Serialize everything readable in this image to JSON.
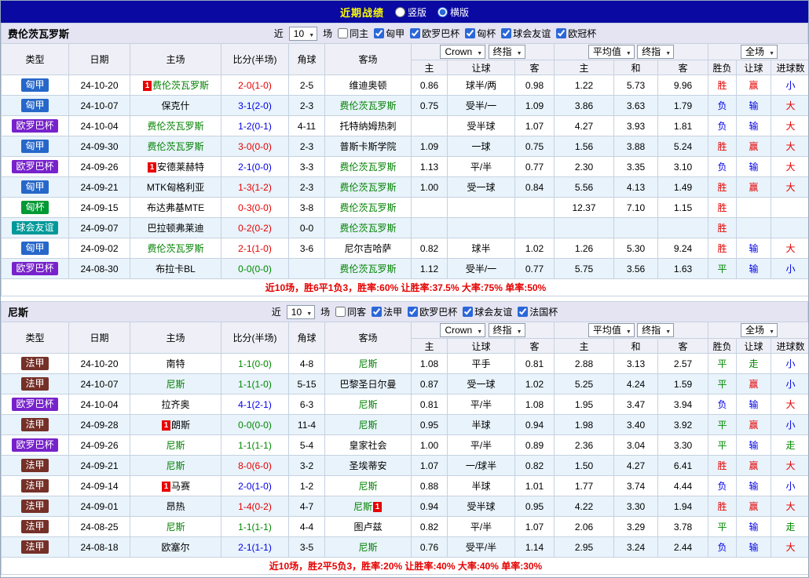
{
  "topbar": {
    "title": "近期战绩",
    "vertical_label": "竖版",
    "horizontal_label": "横版",
    "selected": "横版"
  },
  "controls": {
    "recent_label": "近",
    "count": "10",
    "matches_label": "场",
    "odds_company": "Crown",
    "final_index": "终指",
    "average": "平均值",
    "full_match": "全场"
  },
  "columns": {
    "type": "类型",
    "date": "日期",
    "home": "主场",
    "score": "比分(半场)",
    "corner": "角球",
    "away": "客场",
    "handicap_home": "主",
    "handicap": "让球",
    "handicap_away": "客",
    "odds_home": "主",
    "odds_draw": "和",
    "odds_away": "客",
    "result": "胜负",
    "handicap_result": "让球",
    "goals_result": "进球数"
  },
  "colors": {
    "topbar_bg": "#0A0AA2",
    "win": "#E60000",
    "draw": "#008800",
    "loss": "#0000E6",
    "focus_team": "#008000",
    "alt_row_bg": "#E8F3FB"
  },
  "competition_colors": {
    "匈甲": "#2667C9",
    "欧罗巴杯": "#7722CC",
    "匈杯": "#009933",
    "球会友谊": "#009999",
    "法甲": "#753028",
    "法国杯": "#753028",
    "欧冠杯": "#2667C9"
  },
  "sections": [
    {
      "team": "费伦茨瓦罗斯",
      "filter": {
        "venue_label": "同主",
        "venue_checked": false,
        "competitions": [
          {
            "label": "匈甲",
            "checked": true
          },
          {
            "label": "欧罗巴杯",
            "checked": true
          },
          {
            "label": "匈杯",
            "checked": true
          },
          {
            "label": "球会友谊",
            "checked": true
          },
          {
            "label": "欧冠杯",
            "checked": true
          }
        ]
      },
      "rows": [
        {
          "comp": "匈甲",
          "date": "24-10-20",
          "home": "费伦茨瓦罗斯",
          "home_focus": true,
          "home_card": "1",
          "away": "维迪奥顿",
          "away_focus": false,
          "away_card": "",
          "score": "2-0(1-0)",
          "score_c": "r",
          "corner": "2-5",
          "ah_home": "0.86",
          "ah_line": "球半/两",
          "ah_away": "0.98",
          "o_home": "1.22",
          "o_draw": "5.73",
          "o_away": "9.96",
          "res": "胜",
          "res_c": "r",
          "ah_res": "赢",
          "ah_res_c": "r",
          "ou_res": "小",
          "ou_res_c": "b"
        },
        {
          "comp": "匈甲",
          "date": "24-10-07",
          "home": "保克什",
          "home_focus": false,
          "home_card": "",
          "away": "费伦茨瓦罗斯",
          "away_focus": true,
          "away_card": "",
          "score": "3-1(2-0)",
          "score_c": "b",
          "corner": "2-3",
          "ah_home": "0.75",
          "ah_line": "受半/一",
          "ah_away": "1.09",
          "o_home": "3.86",
          "o_draw": "3.63",
          "o_away": "1.79",
          "res": "负",
          "res_c": "b",
          "ah_res": "输",
          "ah_res_c": "b",
          "ou_res": "大",
          "ou_res_c": "r"
        },
        {
          "comp": "欧罗巴杯",
          "date": "24-10-04",
          "home": "费伦茨瓦罗斯",
          "home_focus": true,
          "home_card": "",
          "away": "托特纳姆热刺",
          "away_focus": false,
          "away_card": "",
          "score": "1-2(0-1)",
          "score_c": "b",
          "corner": "4-11",
          "ah_home": "",
          "ah_line": "受半球",
          "ah_away": "1.07",
          "o_home": "4.27",
          "o_draw": "3.93",
          "o_away": "1.81",
          "res": "负",
          "res_c": "b",
          "ah_res": "输",
          "ah_res_c": "b",
          "ou_res": "大",
          "ou_res_c": "r"
        },
        {
          "comp": "匈甲",
          "date": "24-09-30",
          "home": "费伦茨瓦罗斯",
          "home_focus": true,
          "home_card": "",
          "away": "普斯卡斯学院",
          "away_focus": false,
          "away_card": "",
          "score": "3-0(0-0)",
          "score_c": "r",
          "corner": "2-3",
          "ah_home": "1.09",
          "ah_line": "一球",
          "ah_away": "0.75",
          "o_home": "1.56",
          "o_draw": "3.88",
          "o_away": "5.24",
          "res": "胜",
          "res_c": "r",
          "ah_res": "赢",
          "ah_res_c": "r",
          "ou_res": "大",
          "ou_res_c": "r"
        },
        {
          "comp": "欧罗巴杯",
          "date": "24-09-26",
          "home": "安德莱赫特",
          "home_focus": false,
          "home_card": "1",
          "away": "费伦茨瓦罗斯",
          "away_focus": true,
          "away_card": "",
          "score": "2-1(0-0)",
          "score_c": "b",
          "corner": "3-3",
          "ah_home": "1.13",
          "ah_line": "平/半",
          "ah_away": "0.77",
          "o_home": "2.30",
          "o_draw": "3.35",
          "o_away": "3.10",
          "res": "负",
          "res_c": "b",
          "ah_res": "输",
          "ah_res_c": "b",
          "ou_res": "大",
          "ou_res_c": "r"
        },
        {
          "comp": "匈甲",
          "date": "24-09-21",
          "home": "MTK匈格利亚",
          "home_focus": false,
          "home_card": "",
          "away": "费伦茨瓦罗斯",
          "away_focus": true,
          "away_card": "",
          "score": "1-3(1-2)",
          "score_c": "r",
          "corner": "2-3",
          "ah_home": "1.00",
          "ah_line": "受一球",
          "ah_away": "0.84",
          "o_home": "5.56",
          "o_draw": "4.13",
          "o_away": "1.49",
          "res": "胜",
          "res_c": "r",
          "ah_res": "赢",
          "ah_res_c": "r",
          "ou_res": "大",
          "ou_res_c": "r"
        },
        {
          "comp": "匈杯",
          "date": "24-09-15",
          "home": "布达弗基MTE",
          "home_focus": false,
          "home_card": "",
          "away": "费伦茨瓦罗斯",
          "away_focus": true,
          "away_card": "",
          "score": "0-3(0-0)",
          "score_c": "r",
          "corner": "3-8",
          "ah_home": "",
          "ah_line": "",
          "ah_away": "",
          "o_home": "12.37",
          "o_draw": "7.10",
          "o_away": "1.15",
          "res": "胜",
          "res_c": "r",
          "ah_res": "",
          "ah_res_c": "",
          "ou_res": "",
          "ou_res_c": ""
        },
        {
          "comp": "球会友谊",
          "date": "24-09-07",
          "home": "巴拉顿弗莱迪",
          "home_focus": false,
          "home_card": "",
          "away": "费伦茨瓦罗斯",
          "away_focus": true,
          "away_card": "",
          "score": "0-2(0-2)",
          "score_c": "r",
          "corner": "0-0",
          "ah_home": "",
          "ah_line": "",
          "ah_away": "",
          "o_home": "",
          "o_draw": "",
          "o_away": "",
          "res": "胜",
          "res_c": "r",
          "ah_res": "",
          "ah_res_c": "",
          "ou_res": "",
          "ou_res_c": ""
        },
        {
          "comp": "匈甲",
          "date": "24-09-02",
          "home": "费伦茨瓦罗斯",
          "home_focus": true,
          "home_card": "",
          "away": "尼尔吉哈萨",
          "away_focus": false,
          "away_card": "",
          "score": "2-1(1-0)",
          "score_c": "r",
          "corner": "3-6",
          "ah_home": "0.82",
          "ah_line": "球半",
          "ah_away": "1.02",
          "o_home": "1.26",
          "o_draw": "5.30",
          "o_away": "9.24",
          "res": "胜",
          "res_c": "r",
          "ah_res": "输",
          "ah_res_c": "b",
          "ou_res": "大",
          "ou_res_c": "r"
        },
        {
          "comp": "欧罗巴杯",
          "date": "24-08-30",
          "home": "布拉卡BL",
          "home_focus": false,
          "home_card": "",
          "away": "费伦茨瓦罗斯",
          "away_focus": true,
          "away_card": "",
          "score": "0-0(0-0)",
          "score_c": "g",
          "corner": "",
          "ah_home": "1.12",
          "ah_line": "受半/一",
          "ah_away": "0.77",
          "o_home": "5.75",
          "o_draw": "3.56",
          "o_away": "1.63",
          "res": "平",
          "res_c": "g",
          "ah_res": "输",
          "ah_res_c": "b",
          "ou_res": "小",
          "ou_res_c": "b"
        }
      ],
      "summary": "近10场，胜6平1负3，胜率:60% 让胜率:37.5% 大率:75% 单率:50%"
    },
    {
      "team": "尼斯",
      "filter": {
        "venue_label": "同客",
        "venue_checked": false,
        "competitions": [
          {
            "label": "法甲",
            "checked": true
          },
          {
            "label": "欧罗巴杯",
            "checked": true
          },
          {
            "label": "球会友谊",
            "checked": true
          },
          {
            "label": "法国杯",
            "checked": true
          }
        ]
      },
      "rows": [
        {
          "comp": "法甲",
          "date": "24-10-20",
          "home": "南特",
          "home_focus": false,
          "home_card": "",
          "away": "尼斯",
          "away_focus": true,
          "away_card": "",
          "score": "1-1(0-0)",
          "score_c": "g",
          "corner": "4-8",
          "ah_home": "1.08",
          "ah_line": "平手",
          "ah_away": "0.81",
          "o_home": "2.88",
          "o_draw": "3.13",
          "o_away": "2.57",
          "res": "平",
          "res_c": "g",
          "ah_res": "走",
          "ah_res_c": "g",
          "ou_res": "小",
          "ou_res_c": "b"
        },
        {
          "comp": "法甲",
          "date": "24-10-07",
          "home": "尼斯",
          "home_focus": true,
          "home_card": "",
          "away": "巴黎圣日尔曼",
          "away_focus": false,
          "away_card": "",
          "score": "1-1(1-0)",
          "score_c": "g",
          "corner": "5-15",
          "ah_home": "0.87",
          "ah_line": "受一球",
          "ah_away": "1.02",
          "o_home": "5.25",
          "o_draw": "4.24",
          "o_away": "1.59",
          "res": "平",
          "res_c": "g",
          "ah_res": "赢",
          "ah_res_c": "r",
          "ou_res": "小",
          "ou_res_c": "b"
        },
        {
          "comp": "欧罗巴杯",
          "date": "24-10-04",
          "home": "拉齐奥",
          "home_focus": false,
          "home_card": "",
          "away": "尼斯",
          "away_focus": true,
          "away_card": "",
          "score": "4-1(2-1)",
          "score_c": "b",
          "corner": "6-3",
          "ah_home": "0.81",
          "ah_line": "平/半",
          "ah_away": "1.08",
          "o_home": "1.95",
          "o_draw": "3.47",
          "o_away": "3.94",
          "res": "负",
          "res_c": "b",
          "ah_res": "输",
          "ah_res_c": "b",
          "ou_res": "大",
          "ou_res_c": "r"
        },
        {
          "comp": "法甲",
          "date": "24-09-28",
          "home": "朗斯",
          "home_focus": false,
          "home_card": "1",
          "away": "尼斯",
          "away_focus": true,
          "away_card": "",
          "score": "0-0(0-0)",
          "score_c": "g",
          "corner": "11-4",
          "ah_home": "0.95",
          "ah_line": "半球",
          "ah_away": "0.94",
          "o_home": "1.98",
          "o_draw": "3.40",
          "o_away": "3.92",
          "res": "平",
          "res_c": "g",
          "ah_res": "赢",
          "ah_res_c": "r",
          "ou_res": "小",
          "ou_res_c": "b"
        },
        {
          "comp": "欧罗巴杯",
          "date": "24-09-26",
          "home": "尼斯",
          "home_focus": true,
          "home_card": "",
          "away": "皇家社会",
          "away_focus": false,
          "away_card": "",
          "score": "1-1(1-1)",
          "score_c": "g",
          "corner": "5-4",
          "ah_home": "1.00",
          "ah_line": "平/半",
          "ah_away": "0.89",
          "o_home": "2.36",
          "o_draw": "3.04",
          "o_away": "3.30",
          "res": "平",
          "res_c": "g",
          "ah_res": "输",
          "ah_res_c": "b",
          "ou_res": "走",
          "ou_res_c": "g"
        },
        {
          "comp": "法甲",
          "date": "24-09-21",
          "home": "尼斯",
          "home_focus": true,
          "home_card": "",
          "away": "圣埃蒂安",
          "away_focus": false,
          "away_card": "",
          "score": "8-0(6-0)",
          "score_c": "r",
          "corner": "3-2",
          "ah_home": "1.07",
          "ah_line": "一/球半",
          "ah_away": "0.82",
          "o_home": "1.50",
          "o_draw": "4.27",
          "o_away": "6.41",
          "res": "胜",
          "res_c": "r",
          "ah_res": "赢",
          "ah_res_c": "r",
          "ou_res": "大",
          "ou_res_c": "r"
        },
        {
          "comp": "法甲",
          "date": "24-09-14",
          "home": "马赛",
          "home_focus": false,
          "home_card": "1",
          "away": "尼斯",
          "away_focus": true,
          "away_card": "",
          "score": "2-0(1-0)",
          "score_c": "b",
          "corner": "1-2",
          "ah_home": "0.88",
          "ah_line": "半球",
          "ah_away": "1.01",
          "o_home": "1.77",
          "o_draw": "3.74",
          "o_away": "4.44",
          "res": "负",
          "res_c": "b",
          "ah_res": "输",
          "ah_res_c": "b",
          "ou_res": "小",
          "ou_res_c": "b"
        },
        {
          "comp": "法甲",
          "date": "24-09-01",
          "home": "昂热",
          "home_focus": false,
          "home_card": "",
          "away": "尼斯",
          "away_focus": true,
          "away_card": "1",
          "score": "1-4(0-2)",
          "score_c": "r",
          "corner": "4-7",
          "ah_home": "0.94",
          "ah_line": "受半球",
          "ah_away": "0.95",
          "o_home": "4.22",
          "o_draw": "3.30",
          "o_away": "1.94",
          "res": "胜",
          "res_c": "r",
          "ah_res": "赢",
          "ah_res_c": "r",
          "ou_res": "大",
          "ou_res_c": "r"
        },
        {
          "comp": "法甲",
          "date": "24-08-25",
          "home": "尼斯",
          "home_focus": true,
          "home_card": "",
          "away": "图卢兹",
          "away_focus": false,
          "away_card": "",
          "score": "1-1(1-1)",
          "score_c": "g",
          "corner": "4-4",
          "ah_home": "0.82",
          "ah_line": "平/半",
          "ah_away": "1.07",
          "o_home": "2.06",
          "o_draw": "3.29",
          "o_away": "3.78",
          "res": "平",
          "res_c": "g",
          "ah_res": "输",
          "ah_res_c": "b",
          "ou_res": "走",
          "ou_res_c": "g"
        },
        {
          "comp": "法甲",
          "date": "24-08-18",
          "home": "欧塞尔",
          "home_focus": false,
          "home_card": "",
          "away": "尼斯",
          "away_focus": true,
          "away_card": "",
          "score": "2-1(1-1)",
          "score_c": "b",
          "corner": "3-5",
          "ah_home": "0.76",
          "ah_line": "受平/半",
          "ah_away": "1.14",
          "o_home": "2.95",
          "o_draw": "3.24",
          "o_away": "2.44",
          "res": "负",
          "res_c": "b",
          "ah_res": "输",
          "ah_res_c": "b",
          "ou_res": "大",
          "ou_res_c": "r"
        }
      ],
      "summary": "近10场，胜2平5负3，胜率:20% 让胜率:40% 大率:40% 单率:30%"
    }
  ]
}
